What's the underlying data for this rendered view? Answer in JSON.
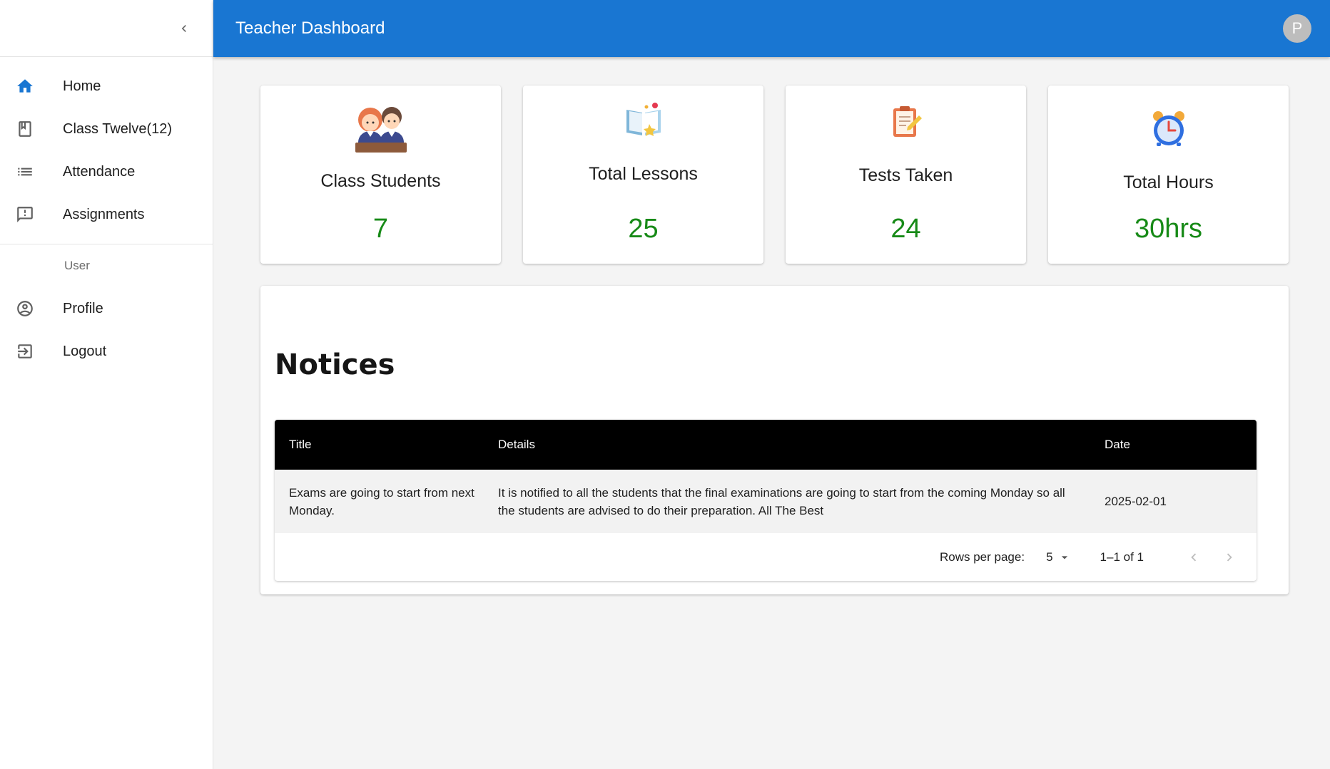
{
  "header": {
    "title": "Teacher Dashboard",
    "avatar_letter": "P"
  },
  "sidebar": {
    "items": [
      {
        "label": "Home",
        "icon": "home-icon"
      },
      {
        "label": "Class Twelve(12)",
        "icon": "class-book-icon"
      },
      {
        "label": "Attendance",
        "icon": "list-icon"
      },
      {
        "label": "Assignments",
        "icon": "feedback-icon"
      }
    ],
    "user_section": {
      "header": "User",
      "items": [
        {
          "label": "Profile",
          "icon": "account-circle-icon"
        },
        {
          "label": "Logout",
          "icon": "logout-icon"
        }
      ]
    }
  },
  "stats": [
    {
      "label": "Class Students",
      "value": "7",
      "icon": "students-illustration"
    },
    {
      "label": "Total Lessons",
      "value": "25",
      "icon": "open-book-illustration"
    },
    {
      "label": "Tests Taken",
      "value": "24",
      "icon": "clipboard-illustration"
    },
    {
      "label": "Total Hours",
      "value": "30hrs",
      "icon": "alarm-clock-illustration"
    }
  ],
  "colors": {
    "primary": "#1976d2",
    "stat_value": "#178a17"
  },
  "notices": {
    "title": "Notices",
    "columns": [
      "Title",
      "Details",
      "Date"
    ],
    "rows": [
      {
        "title": "Exams are going to start from next Monday.",
        "details": "It is notified to all the students that the final examinations are going to start from the coming Monday so all the students are advised to do their preparation. All The Best",
        "date": "2025-02-01"
      }
    ],
    "pagination": {
      "rows_per_page_label": "Rows per page:",
      "rows_per_page": "5",
      "range": "1–1 of 1"
    }
  }
}
